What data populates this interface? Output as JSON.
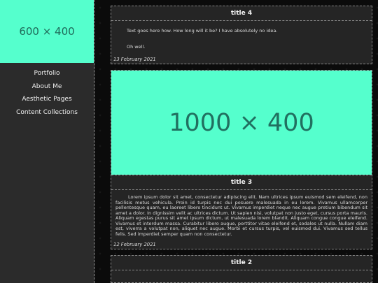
{
  "sidebar": {
    "image_text": "600 × 400",
    "nav": [
      {
        "label": "Portfolio"
      },
      {
        "label": "About Me"
      },
      {
        "label": "Aesthetic Pages"
      },
      {
        "label": "Content Collections"
      }
    ]
  },
  "posts": [
    {
      "title": "title 4",
      "paragraphs": [
        "Text goes here how. How long will it be? I have absolutely no idea.",
        "Oh well."
      ],
      "date": "13 February 2021"
    },
    {
      "image_text": "1000 × 400",
      "title": "title 3",
      "body": "Lorem ipsum dolor sit amet, consectetur adipiscing elit. Nam ultrices ipsum euismod sem eleifend, non facilisis metus vehicula. Proin id turpis nec dui posuere malesuada in eu lorem. Vivamus ullamcorper pellentesque quam, eu laoreet libero tincidunt ut. Vivamus imperdiet neque nec augue pretium bibendum sit amet a dolor. In dignissim velit ac ultrices dictum. Ut sapien nisi, volutpat non justo eget, cursus porta mauris. Aliquam egestas purus sit amet ipsum dictum, ut malesuada lorem blandit. Aliquam congue congue eleifend. Vivamus et interdum massa. Curabitur libero augue, porttitor vitae eleifend et, sodales ut nulla. Nullam diam est, viverra a volutpat non, aliquet nec augue. Morbi et cursus turpis, vel euismod dui. Vivamus sed tellus felis. Sed imperdiet semper quam non consectetur.",
      "date": "12 February 2021"
    },
    {
      "title": "title 2"
    }
  ]
}
